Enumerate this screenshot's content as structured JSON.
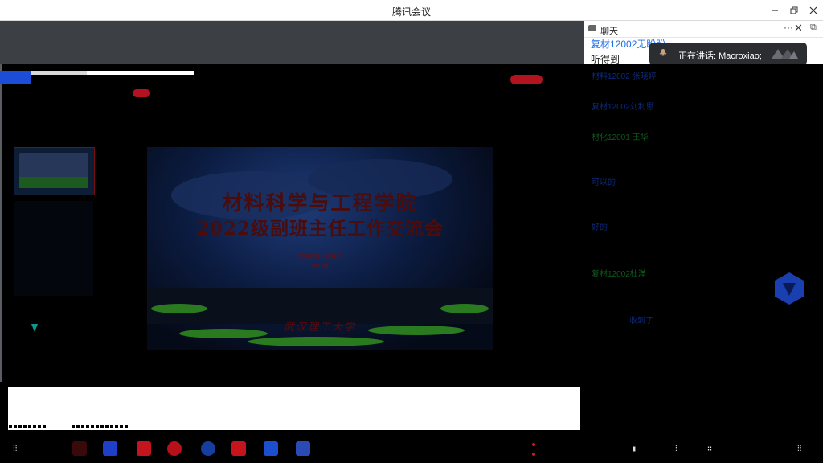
{
  "window": {
    "title": "腾讯会议",
    "minimize_icon": "minimize-icon",
    "restore_icon": "restore-icon",
    "close_icon": "close-icon"
  },
  "chat": {
    "header_label": "聊天",
    "more_label": "···",
    "messages": [
      {
        "text": "复材12002无盼盼",
        "color": "#1f6fe8"
      },
      {
        "text": "听得到",
        "color": "#222222"
      }
    ]
  },
  "speaker": {
    "label": "正在讲话: Macroxiao;"
  },
  "dark_chat": {
    "messages": [
      {
        "text": "材料12002 张晓婷",
        "color": "blue"
      },
      {
        "text": "复材12002刘利思",
        "color": "blue"
      },
      {
        "text": "材化12001 王华",
        "color": "green"
      },
      {
        "text": "可以的",
        "color": "blue"
      },
      {
        "text": "好的",
        "color": "blue"
      },
      {
        "text": "复材12002杜洋",
        "color": "green"
      },
      {
        "text": "收到了",
        "color": "blue"
      }
    ]
  },
  "slide": {
    "title_line1": "材料科学与工程学院",
    "title_line2": "2022级副班主任工作交流会",
    "presenter": "材料学院 · 辅导员",
    "date": "2022年",
    "signature": "武汉理工大学"
  },
  "colors": {
    "accent_blue": "#1b4dd6",
    "alert_red": "#b3131e",
    "chat_link": "#1f6fe8",
    "speaker_bg": "#2b2d31"
  }
}
